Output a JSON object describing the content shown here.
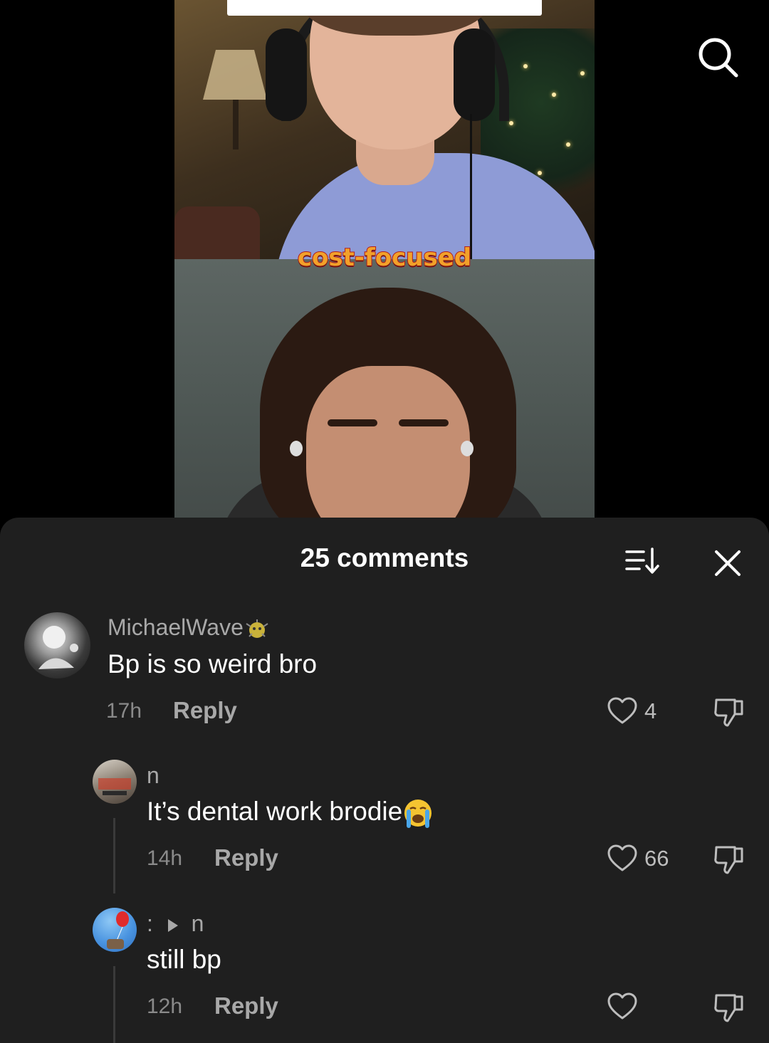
{
  "video": {
    "overlay_text": "cost-focused"
  },
  "header": {
    "search_icon": "search-icon"
  },
  "comments_panel": {
    "title": "25 comments",
    "sort_icon": "sort-icon",
    "close_icon": "close-icon",
    "comments": [
      {
        "username": "MichaelWave",
        "badge_icon": "badge-emoji-icon",
        "text": "Bp is so weird bro",
        "time": "17h",
        "reply_label": "Reply",
        "likes": "4"
      },
      {
        "username": "n",
        "text": "It’s dental work brodie",
        "emoji": "crying-face-emoji",
        "time": "14h",
        "reply_label": "Reply",
        "likes": "66"
      },
      {
        "username": ":",
        "reply_to": "n",
        "text": "still bp",
        "time": "12h",
        "reply_label": "Reply",
        "likes": ""
      }
    ]
  },
  "colors": {
    "sheet_bg": "#1f1f1f",
    "secondary_text": "#a8a8a8",
    "overlay_text": "#f2a12a"
  }
}
